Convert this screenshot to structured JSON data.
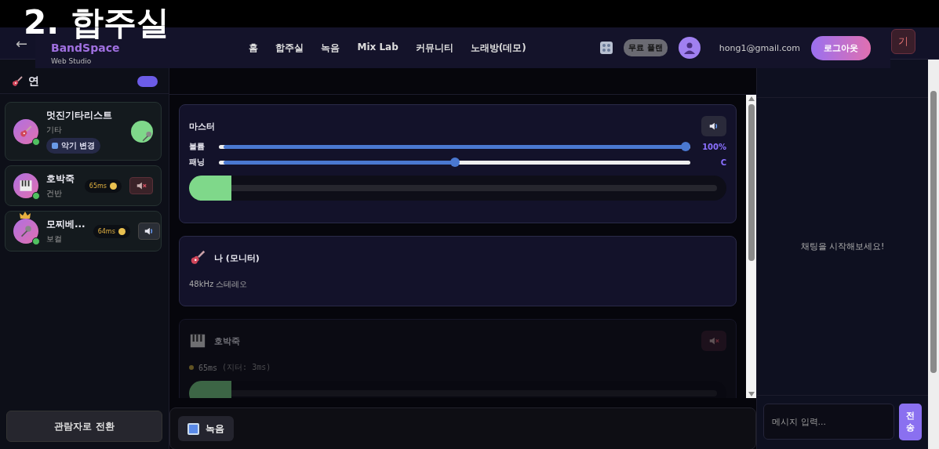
{
  "caption": "2. 합주실",
  "app_bar": {
    "back": "←",
    "right_button": "기"
  },
  "nav": {
    "logo": "BandSpace",
    "tagline": "Web Studio",
    "links": [
      {
        "label": "홈"
      },
      {
        "label": "합주실"
      },
      {
        "label": "녹음"
      },
      {
        "label": "Mix Lab"
      },
      {
        "label": "커뮤니티"
      },
      {
        "label": "노래방(데모)"
      }
    ],
    "plan_badge": "무료 플랜",
    "email": "hong1@gmail.com",
    "logout": "로그아웃"
  },
  "performers": {
    "title": "연",
    "members": [
      {
        "kind": "self",
        "name": "멋진기타리스트",
        "instrument": "기타",
        "online": true,
        "host": false,
        "action": "악기 변경"
      },
      {
        "kind": "remote",
        "name": "호박죽",
        "instrument": "건반",
        "online": true,
        "host": false,
        "latency": "65ms",
        "muted": true
      },
      {
        "kind": "remote",
        "name": "모찌베...",
        "instrument": "보컬",
        "online": true,
        "host": true,
        "latency": "64ms",
        "muted": false
      }
    ],
    "switch_button": "관람자로 전환"
  },
  "mixer": {
    "channels": [
      {
        "kind": "master",
        "name": "마스터",
        "muted": false,
        "volume_label": "볼륨",
        "volume": {
          "level": 1
        },
        "volume_reading": "100%",
        "pan_label": "패닝",
        "pan": {
          "level": 0.5
        },
        "pan_reading": "C",
        "meter": {
          "level": 0.08
        }
      },
      {
        "kind": "monitor",
        "name": "나 (모니터)",
        "detail": "48kHz 스테레오"
      },
      {
        "kind": "remote",
        "name": "호박죽",
        "muted": true,
        "latency": "65ms",
        "jitter": "(지터: 3ms)",
        "meter": {
          "level": 0.08
        }
      }
    ],
    "record_button": "녹음"
  },
  "chat": {
    "empty_message": "채팅을 시작해보세요!",
    "input_placeholder": "메시지 입력...",
    "send": "전송"
  }
}
